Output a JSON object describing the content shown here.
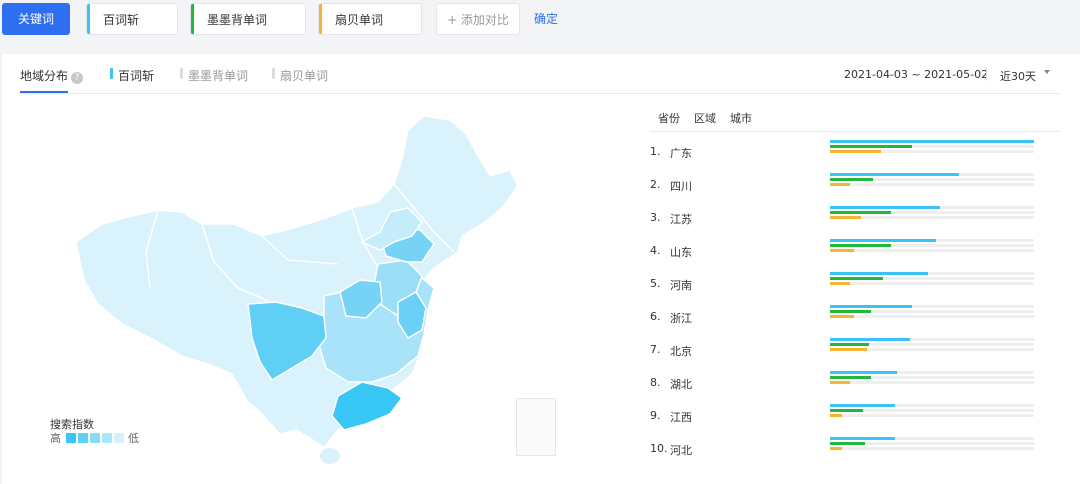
{
  "toolbar": {
    "primary_label": "关键词",
    "terms": [
      {
        "label": "百词斩",
        "color": "#3cc3f5"
      },
      {
        "label": "墨墨背单词",
        "color": "#22b83a"
      },
      {
        "label": "扇贝单词",
        "color": "#f5b533"
      }
    ],
    "add_label": "+ 添加对比",
    "confirm_label": "确定"
  },
  "tabs": {
    "region_label": "地域分布",
    "help_glyph": "?",
    "series": [
      "百词斩",
      "墨墨背单词",
      "扇贝单词"
    ]
  },
  "date": {
    "range": "2021-04-03 ~ 2021-05-02",
    "period": "近30天"
  },
  "legend": {
    "title": "搜索指数",
    "high": "高",
    "low": "低",
    "swatches": [
      "#38c6f4",
      "#5fd1f6",
      "#86dcf8",
      "#acE6fa",
      "#d4f1fc"
    ]
  },
  "ranking": {
    "tabs": [
      "省份",
      "区域",
      "城市"
    ],
    "rows": [
      {
        "rank": "1.",
        "name": "广东",
        "values": [
          1.0,
          0.4,
          0.25
        ]
      },
      {
        "rank": "2.",
        "name": "四川",
        "values": [
          0.63,
          0.21,
          0.1
        ]
      },
      {
        "rank": "3.",
        "name": "江苏",
        "values": [
          0.54,
          0.3,
          0.15
        ]
      },
      {
        "rank": "4.",
        "name": "山东",
        "values": [
          0.52,
          0.3,
          0.12
        ]
      },
      {
        "rank": "5.",
        "name": "河南",
        "values": [
          0.48,
          0.26,
          0.1
        ]
      },
      {
        "rank": "6.",
        "name": "浙江",
        "values": [
          0.4,
          0.2,
          0.12
        ]
      },
      {
        "rank": "7.",
        "name": "北京",
        "values": [
          0.39,
          0.19,
          0.18
        ]
      },
      {
        "rank": "8.",
        "name": "湖北",
        "values": [
          0.33,
          0.2,
          0.1
        ]
      },
      {
        "rank": "9.",
        "name": "江西",
        "values": [
          0.32,
          0.16,
          0.06
        ]
      },
      {
        "rank": "10.",
        "name": "河北",
        "values": [
          0.32,
          0.17,
          0.06
        ]
      }
    ]
  }
}
